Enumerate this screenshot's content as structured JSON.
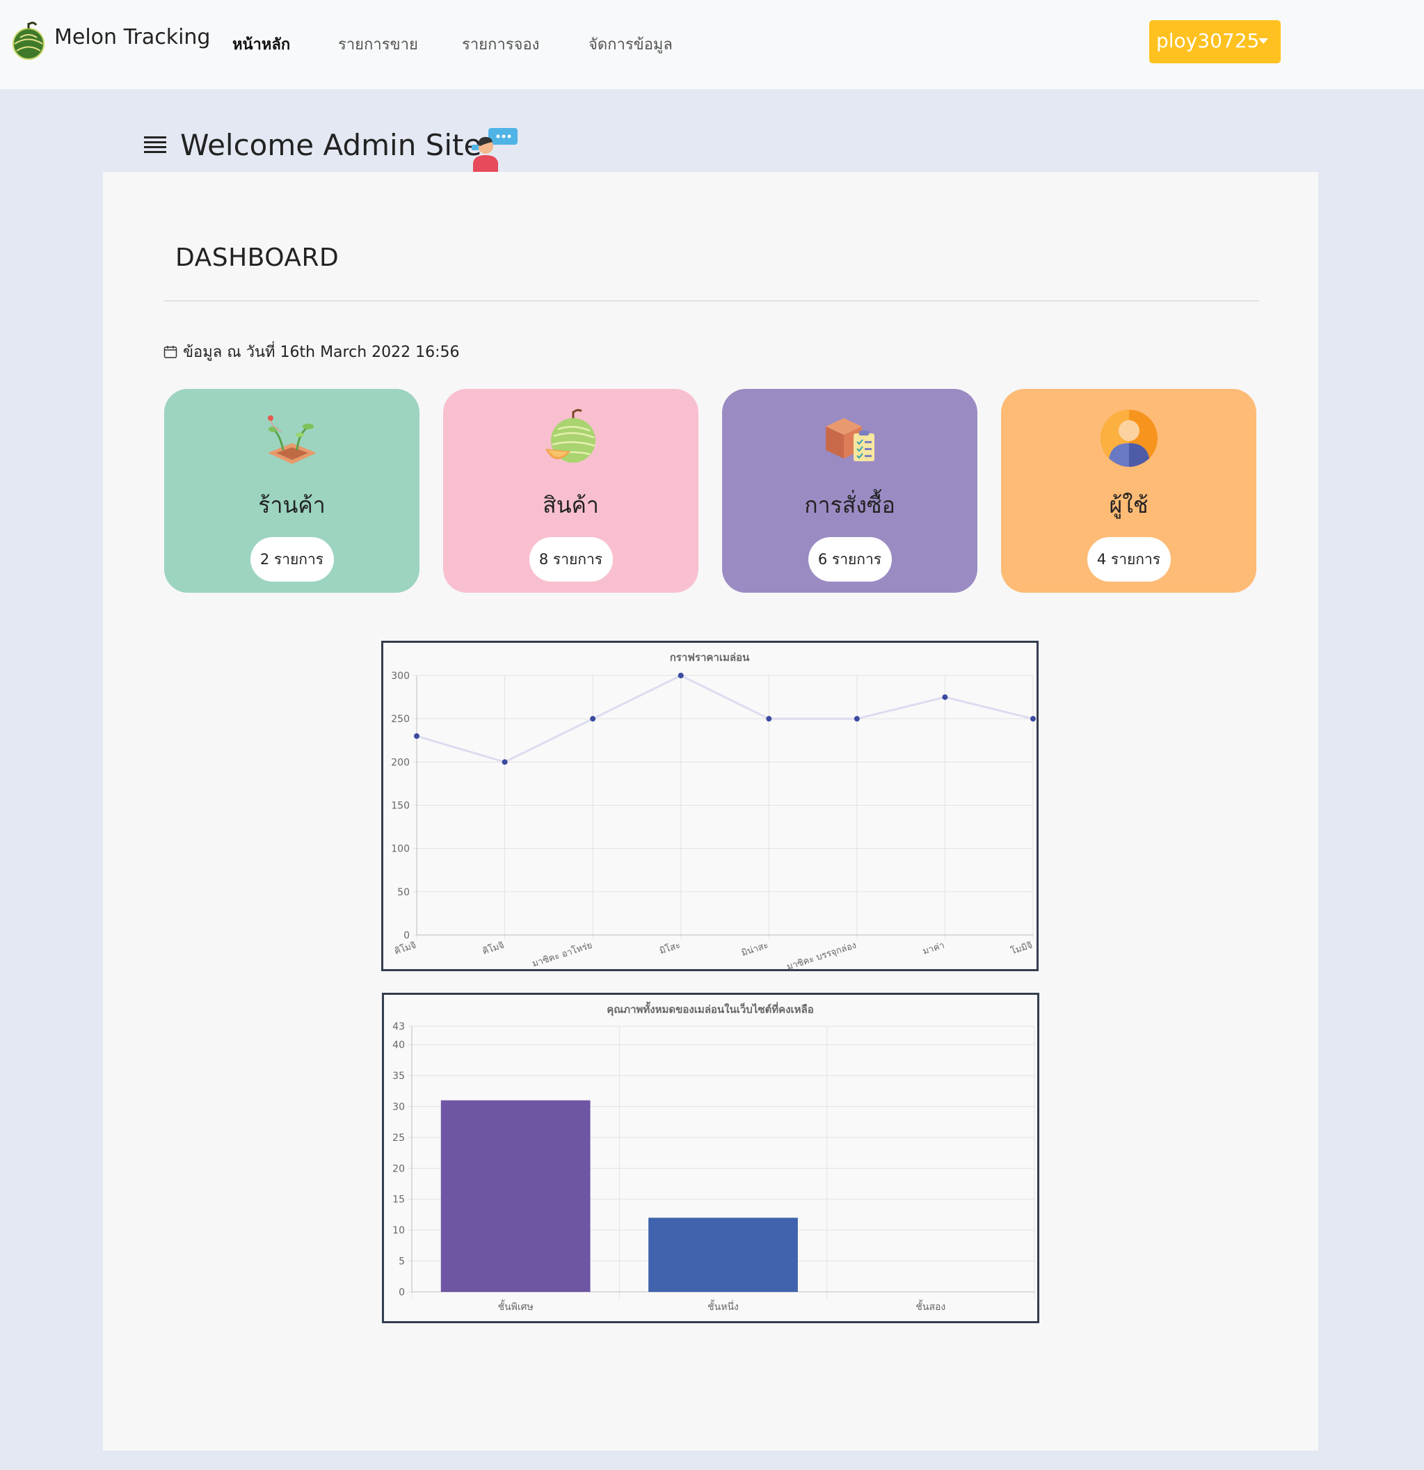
{
  "nav": {
    "brand": "Melon Tracking",
    "links": [
      {
        "label": "หน้าหลัก",
        "active": true
      },
      {
        "label": "รายการขาย",
        "active": false
      },
      {
        "label": "รายการจอง",
        "active": false
      },
      {
        "label": "จัดการข้อมูล",
        "active": false
      }
    ],
    "user": "ploy30725",
    "user_button_color": "#ffc11f"
  },
  "header": {
    "welcome": "Welcome Admin Site"
  },
  "dashboard": {
    "title": "DASHBOARD",
    "date_text": "ข้อมูล ณ วันที่ 16th March 2022 16:56"
  },
  "cards": [
    {
      "title": "ร้านค้า",
      "badge": "2 รายการ",
      "color": "#9cd4c0",
      "icon": "sprout-garden-icon"
    },
    {
      "title": "สินค้า",
      "badge": "8 รายการ",
      "color": "#f8c0cf",
      "icon": "melon-icon"
    },
    {
      "title": "การสั่งซื้อ",
      "badge": "6 รายการ",
      "color": "#9b8bc3",
      "icon": "order-box-icon"
    },
    {
      "title": "ผู้ใช้",
      "badge": "4 รายการ",
      "color": "#fdbb76",
      "icon": "user-avatar-icon"
    }
  ],
  "chart_data": [
    {
      "type": "line",
      "title": "กราฟราคาเมล่อน",
      "categories": [
        "คิโมจิ",
        "คิโมจิ",
        "มาซิคะ อาโหร่ย",
        "มิโสะ",
        "มิน่าสะ",
        "มาซิคะ บรรจุกล่อง",
        "มาค่า",
        "โมมิจิ"
      ],
      "series": [
        {
          "values": [
            230,
            200,
            250,
            300,
            250,
            250,
            275,
            250
          ],
          "color": "#3b4a9e",
          "line_color": "#dcdcf0"
        }
      ],
      "ylim": [
        0,
        300
      ],
      "yticks": [
        0,
        50,
        100,
        150,
        200,
        250,
        300
      ],
      "grid": true
    },
    {
      "type": "bar",
      "title": "คุณภาพทั้งหมดของเมล่อนในเว็บไซต์ที่คงเหลือ",
      "categories": [
        "ชั้นพิเศษ",
        "ชั้นหนึ่ง",
        "ชั้นสอง"
      ],
      "values": [
        31,
        12,
        0
      ],
      "colors": [
        "#6e56a5",
        "#4163ad",
        "#6e56a5"
      ],
      "ylim": [
        0,
        43
      ],
      "yticks": [
        0,
        5,
        10,
        15,
        20,
        25,
        30,
        35,
        40,
        43
      ],
      "grid": true
    }
  ]
}
